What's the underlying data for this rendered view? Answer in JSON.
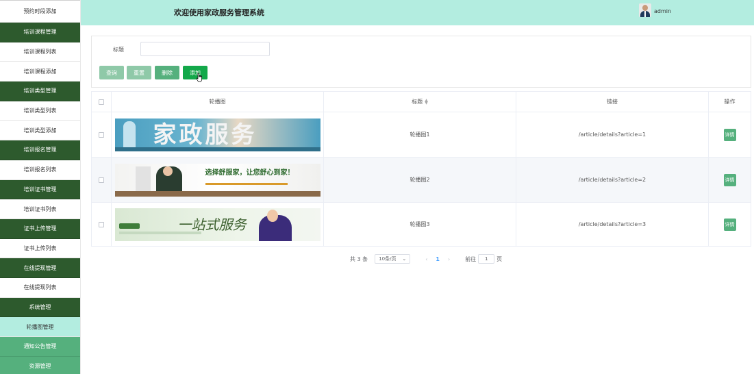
{
  "header": {
    "title": "欢迎使用家政服务管理系统",
    "username": "admin"
  },
  "sidebar": {
    "items": [
      {
        "label": "预约时段添加",
        "kind": "sub"
      },
      {
        "label": "培训课程管理",
        "kind": "group"
      },
      {
        "label": "培训课程列表",
        "kind": "sub"
      },
      {
        "label": "培训课程添加",
        "kind": "sub"
      },
      {
        "label": "培训类型管理",
        "kind": "group"
      },
      {
        "label": "培训类型列表",
        "kind": "sub"
      },
      {
        "label": "培训类型添加",
        "kind": "sub"
      },
      {
        "label": "培训报名管理",
        "kind": "group"
      },
      {
        "label": "培训报名列表",
        "kind": "sub"
      },
      {
        "label": "培训证书管理",
        "kind": "group"
      },
      {
        "label": "培训证书列表",
        "kind": "sub"
      },
      {
        "label": "证书上传管理",
        "kind": "group"
      },
      {
        "label": "证书上传列表",
        "kind": "sub"
      },
      {
        "label": "在线提现管理",
        "kind": "group"
      },
      {
        "label": "在线提现列表",
        "kind": "sub"
      },
      {
        "label": "系统管理",
        "kind": "group"
      },
      {
        "label": "轮播图管理",
        "kind": "active"
      },
      {
        "label": "通知公告管理",
        "kind": "alt"
      },
      {
        "label": "资源管理",
        "kind": "alt"
      }
    ]
  },
  "search": {
    "label": "标题",
    "value": "",
    "placeholder": "",
    "buttons": {
      "query": "查询",
      "reset": "重置",
      "delete": "删除",
      "add": "添加"
    }
  },
  "table": {
    "headers": {
      "image": "轮播图",
      "title": "标题",
      "link": "链接",
      "operation": "操作"
    },
    "rows": [
      {
        "banner_text": "家政服务",
        "title": "轮播图1",
        "link": "/article/details?article=1",
        "op": "详情"
      },
      {
        "banner_text": "选择舒服家，让您舒心到家！",
        "title": "轮播图2",
        "link": "/article/details?article=2",
        "op": "详情"
      },
      {
        "banner_text": "一站式服务",
        "title": "轮播图3",
        "link": "/article/details?article=3",
        "op": "详情"
      }
    ]
  },
  "pagination": {
    "total": "共 3 条",
    "page_size": "10条/页",
    "current": "1",
    "goto_label": "前往",
    "goto_value": "1",
    "page_suffix": "页"
  },
  "colors": {
    "header_bg": "#b3ede0",
    "group_bg": "#2d5a2d",
    "active_bg": "#b3ede0",
    "accent": "#55b07d",
    "add_button": "#13a84a"
  }
}
